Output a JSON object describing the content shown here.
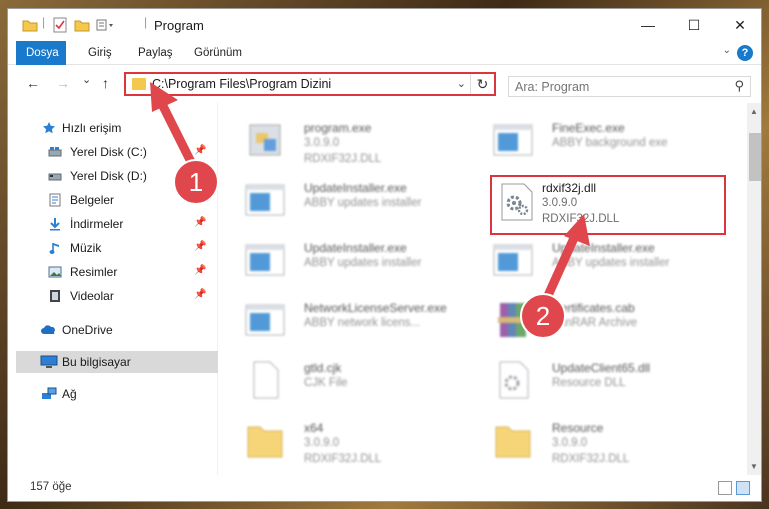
{
  "window": {
    "title": "Program",
    "controls": {
      "minimize": "—",
      "maximize": "☐",
      "close": "✕"
    }
  },
  "ribbon": {
    "tabs": [
      {
        "label": "Dosya",
        "active": true
      },
      {
        "label": "Giriş"
      },
      {
        "label": "Paylaş"
      },
      {
        "label": "Görünüm"
      }
    ],
    "help": "?"
  },
  "nav": {
    "back": "←",
    "forward": "→",
    "recent": "⌄",
    "up": "↑",
    "address": "C:\\Program Files\\Program Dizini",
    "search_placeholder": "Ara: Program"
  },
  "sidebar": {
    "items": [
      {
        "label": "Hızlı erişim",
        "icon": "star-icon"
      },
      {
        "label": "Yerel Disk (C:)",
        "icon": "drive-icon",
        "pinned": true
      },
      {
        "label": "Yerel Disk (D:)",
        "icon": "drive-icon",
        "pinned": true
      },
      {
        "label": "Belgeler",
        "icon": "documents-icon"
      },
      {
        "label": "İndirmeler",
        "icon": "download-icon",
        "pinned": true
      },
      {
        "label": "Müzik",
        "icon": "music-icon",
        "pinned": true
      },
      {
        "label": "Resimler",
        "icon": "pictures-icon",
        "pinned": true
      },
      {
        "label": "Videolar",
        "icon": "videos-icon",
        "pinned": true
      },
      {
        "label": "OneDrive",
        "icon": "cloud-icon"
      },
      {
        "label": "Bu bilgisayar",
        "icon": "computer-icon",
        "selected": true
      },
      {
        "label": "Ağ",
        "icon": "network-icon"
      }
    ]
  },
  "files": [
    {
      "name": "program.exe",
      "line1": "3.0.9.0",
      "line2": "RDXIF32J.DLL",
      "icon": "exe-icon"
    },
    {
      "name": "FineExec.exe",
      "line1": "ABBY background exe",
      "line2": "",
      "icon": "window-icon"
    },
    {
      "name": "UpdateInstaller.exe",
      "line1": "ABBY updates installer",
      "line2": "",
      "icon": "window-icon"
    },
    {
      "name": "rdxif32j.dll",
      "line1": "3.0.9.0",
      "line2": "RDXIF32J.DLL",
      "icon": "dll-gear-icon",
      "highlight": true
    },
    {
      "name": "UpdateInstaller.exe",
      "line1": "ABBY updates installer",
      "line2": "",
      "icon": "window-icon"
    },
    {
      "name": "UpdateInstaller.exe",
      "line1": "ABBY updates installer",
      "line2": "",
      "icon": "window-icon"
    },
    {
      "name": "NetworkLicenseServer.exe",
      "line1": "ABBY network licens...",
      "line2": "",
      "icon": "window-icon"
    },
    {
      "name": "Certificates.cab",
      "line1": "WinRAR Archive",
      "line2": "",
      "icon": "archive-icon"
    },
    {
      "name": "gtld.cjk",
      "line1": "CJK File",
      "line2": "",
      "icon": "blank-file-icon"
    },
    {
      "name": "UpdateClient65.dll",
      "line1": "Resource DLL",
      "line2": "",
      "icon": "dll-icon"
    },
    {
      "name": "x64",
      "line1": "3.0.9.0",
      "line2": "RDXIF32J.DLL",
      "icon": "folder-icon"
    },
    {
      "name": "Resource",
      "line1": "3.0.9.0",
      "line2": "RDXIF32J.DLL",
      "icon": "folder-icon"
    }
  ],
  "status": {
    "count": "157 öğe"
  },
  "annotations": [
    {
      "label": "1",
      "color": "#d9363e"
    },
    {
      "label": "2",
      "color": "#d9363e"
    }
  ]
}
